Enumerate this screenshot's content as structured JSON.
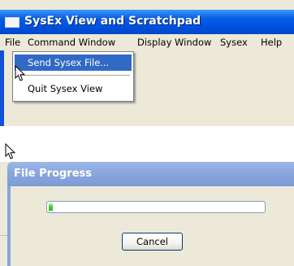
{
  "main_window": {
    "title": "SysEx View and Scratchpad",
    "app_icon": "window-app-icon"
  },
  "menubar": {
    "items": [
      "File",
      "Command Window",
      "Display Window",
      "Sysex",
      "Help"
    ]
  },
  "file_menu": {
    "items": [
      "Send Sysex File...",
      "Quit Sysex View"
    ],
    "highlighted": "Send Sysex File..."
  },
  "dialog": {
    "title": "File Progress",
    "progress_fraction": 0.02,
    "cancel_label": "Cancel"
  },
  "colors": {
    "active_titlebar": "#0054e3",
    "inactive_titlebar": "#8aa6de",
    "menu_highlight": "#316ac5",
    "progress_green": "#37d22a",
    "face": "#ece9d8"
  },
  "icons": [
    "window-app-icon",
    "arrow-cursor-icon"
  ]
}
